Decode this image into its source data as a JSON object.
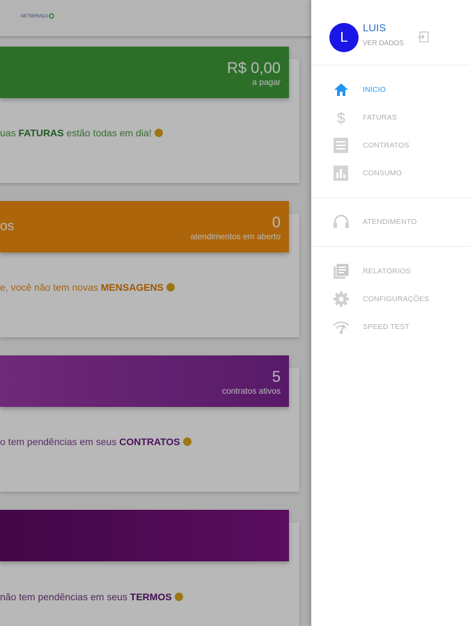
{
  "colors": {
    "faturas_green": "#3f9a3a",
    "atendimentos_orange": "#ef8c0f",
    "contratos_purple": "#8a2f9c",
    "termos_purple": "#6a0a6f",
    "accent_blue": "#2196f3",
    "avatar_blue": "#1a17e6"
  },
  "app": {
    "logo_text": "NETSERVIÇO"
  },
  "cards": [
    {
      "amount": "R$ 0,00",
      "subtitle": "a pagar",
      "title": "",
      "msg_prefix": "uas ",
      "msg_bold": "FATURAS",
      "msg_suffix": " estão todas em dia!"
    },
    {
      "amount": "0",
      "subtitle": "atendimentos em aberto",
      "title": "os",
      "msg_prefix": "e, você não tem novas ",
      "msg_bold": "MENSAGENS",
      "msg_suffix": ""
    },
    {
      "amount": "5",
      "subtitle": "contratos ativos",
      "title": "",
      "msg_prefix": "o tem pendências em seus ",
      "msg_bold": "CONTRATOS",
      "msg_suffix": ""
    },
    {
      "amount": "",
      "subtitle": "",
      "title": "",
      "msg_prefix": "não tem pendências em seus ",
      "msg_bold": "TERMOS",
      "msg_suffix": ""
    }
  ],
  "drawer": {
    "user": {
      "initial": "L",
      "name": "LUIS",
      "link": "VER DADOS"
    },
    "menu": [
      {
        "label": "INÍCIO",
        "icon": "home-icon",
        "active": true
      },
      {
        "label": "FATURAS",
        "icon": "dollar-icon"
      },
      {
        "label": "CONTRATOS",
        "icon": "document-icon"
      },
      {
        "label": "CONSUMO",
        "icon": "bar-chart-icon"
      }
    ],
    "support": [
      {
        "label": "ATENDIMENTO",
        "icon": "headset-icon"
      }
    ],
    "extras": [
      {
        "label": "RELATÓRIOS",
        "icon": "reports-icon"
      },
      {
        "label": "CONFIGURAÇÕES",
        "icon": "gear-icon"
      },
      {
        "label": "SPEED TEST",
        "icon": "speed-wifi-icon"
      }
    ]
  }
}
